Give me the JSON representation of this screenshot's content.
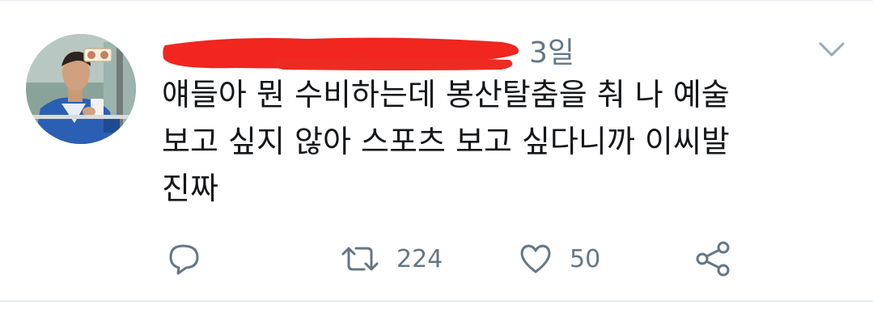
{
  "tweet": {
    "timestamp": "3일",
    "text": "얘들아 뭔 수비하는데 봉산탈춤을 춰 나 예술\n보고 싶지 않아 스포츠 보고 싶다니까 이씨발\n진짜",
    "author_redacted": true
  },
  "actions": {
    "reply": {
      "icon": "reply-icon"
    },
    "retweet": {
      "icon": "retweet-icon",
      "count": "224"
    },
    "like": {
      "icon": "heart-icon",
      "count": "50"
    },
    "share": {
      "icon": "share-icon"
    }
  },
  "colors": {
    "text": "#14171a",
    "secondary": "#657786",
    "redaction": "#f0261f",
    "divider": "#e6ecf0"
  }
}
